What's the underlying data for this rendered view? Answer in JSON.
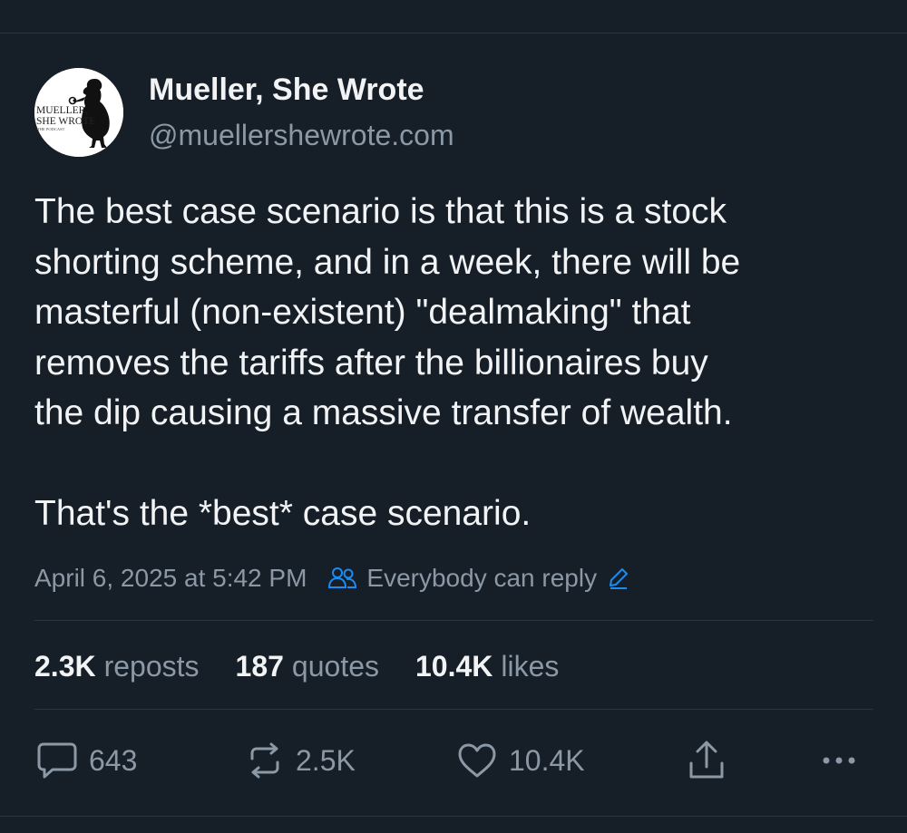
{
  "author": {
    "name": "Mueller, She Wrote",
    "handle": "@muellershewrote.com",
    "avatar_text": [
      "MUELLER,",
      "SHE WROTE",
      "THE PODCAST"
    ]
  },
  "post": {
    "text": "The best case scenario is that this is a stock\nshorting scheme, and in a week, there will be\nmasterful (non-existent) \"dealmaking\" that\nremoves the tariffs after the billionaires buy\nthe dip causing a massive transfer of wealth.",
    "text2": "That's the *best* case scenario."
  },
  "meta": {
    "timestamp": "April 6, 2025 at 5:42 PM",
    "audience": "Everybody can reply"
  },
  "stats": {
    "reposts_count": "2.3K",
    "reposts_label": "reposts",
    "quotes_count": "187",
    "quotes_label": "quotes",
    "likes_count": "10.4K",
    "likes_label": "likes"
  },
  "actions": {
    "reply_count": "643",
    "repost_count": "2.5K",
    "like_count": "10.4K",
    "icons": [
      "reply-icon",
      "repost-icon",
      "like-icon",
      "share-icon",
      "more-icon"
    ]
  },
  "colors": {
    "background": "#161e27",
    "primary_text": "#f1f3f5",
    "secondary_text": "#8b98a5",
    "divider": "#2a343f",
    "accent": "#1d8cf0"
  }
}
